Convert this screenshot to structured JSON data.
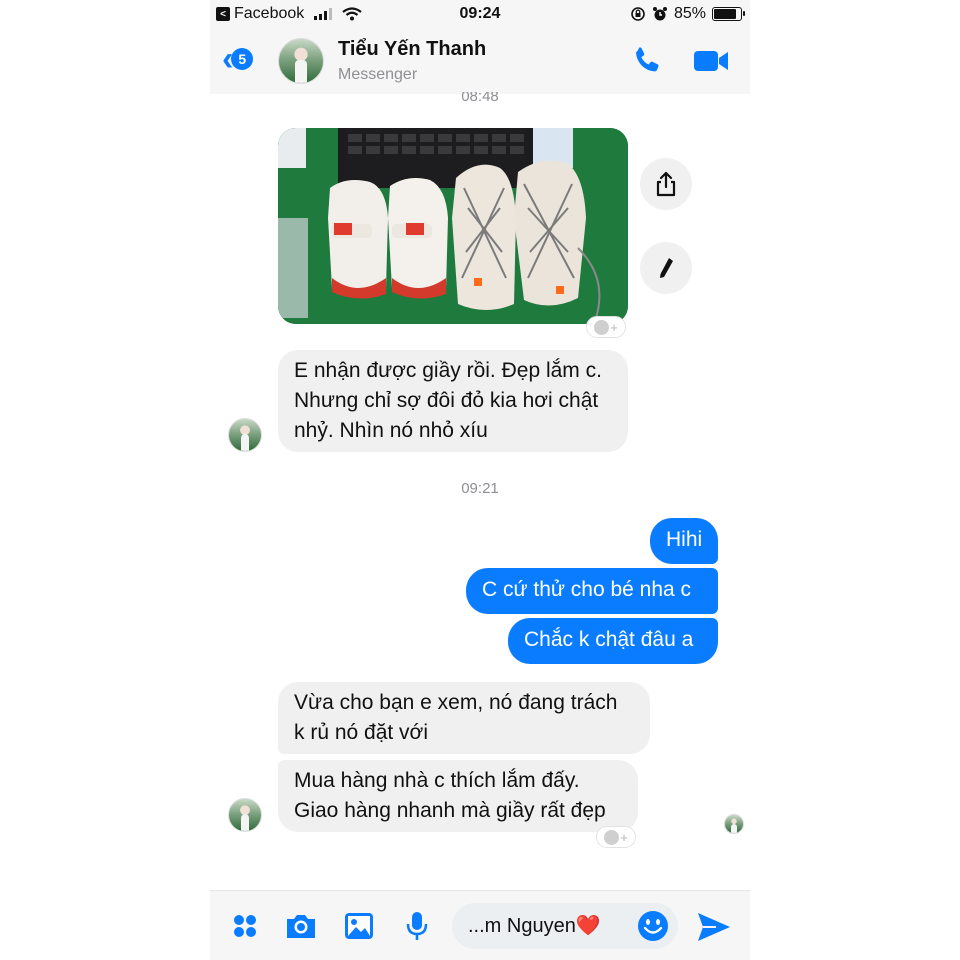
{
  "status_bar": {
    "back_app_label": "Facebook",
    "time": "09:24",
    "battery_percent": "85%",
    "battery_level": 0.85
  },
  "header": {
    "back_count": "5",
    "contact_name": "Tiểu Yến Thanh",
    "subtitle": "Messenger",
    "icons": [
      "chevron-left-icon",
      "phone-icon",
      "video-camera-icon"
    ],
    "accent_color": "#0a7cff"
  },
  "chat": {
    "timestamp_1": "08:48",
    "timestamp_2": "09:21",
    "incoming_1": [
      "E nhận được giầy rồi. Đẹp lắm c.",
      "Nhưng chỉ sợ đôi đỏ kia hơi chật",
      "nhỷ. Nhìn nó nhỏ xíu"
    ],
    "outgoing": [
      "Hihi",
      "C cứ thử cho bé nha c",
      "Chắc k chật đâu a"
    ],
    "incoming_2": [
      "Vừa cho bạn e xem, nó đang trách",
      "k rủ nó đặt với"
    ],
    "incoming_3": [
      "Mua hàng nhà c thích lắm đấy.",
      "Giao hàng nhanh mà giầy rất đẹp"
    ],
    "incoming_color": "#f1f0f0",
    "outgoing_color": "#0a7cff"
  },
  "composer": {
    "input_value": "...m Nguyen",
    "heart": "❤️",
    "icons": [
      "apps-icon",
      "camera-icon",
      "image-icon",
      "microphone-icon",
      "emoji-icon",
      "send-icon"
    ]
  }
}
